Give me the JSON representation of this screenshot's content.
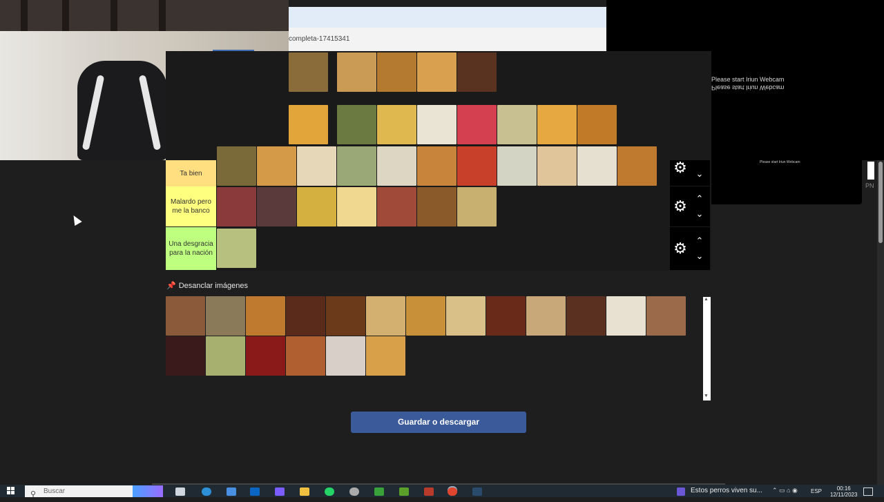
{
  "webcam": {
    "label": "webcam-feed"
  },
  "browser": {
    "url_fragment": "completa-17415341"
  },
  "obs": {
    "message1": "Please start Iriun Webcam",
    "message2": "Please start Iriun Webcam",
    "tiny": "Please start Iriun Webcam"
  },
  "tiers": [
    {
      "label": "Ta bien",
      "color": "#ffdf80"
    },
    {
      "label": "Malardo pero me la banco",
      "color": "#ffff7f"
    },
    {
      "label": "Una desgracia para la nación",
      "color": "#bfff7f"
    }
  ],
  "unpin": {
    "label": "Desanclar imágenes"
  },
  "save_button": {
    "label": "Guardar o descargar"
  },
  "side": {
    "pn": "PN"
  },
  "taskbar": {
    "search_placeholder": "Buscar",
    "media_text": "Estos perros viven su...",
    "lang": "ESP",
    "time": "00:16",
    "date": "12/11/2023"
  },
  "colors": {
    "accent_button": "#3b5a9a",
    "background": "#1e1e1e"
  }
}
